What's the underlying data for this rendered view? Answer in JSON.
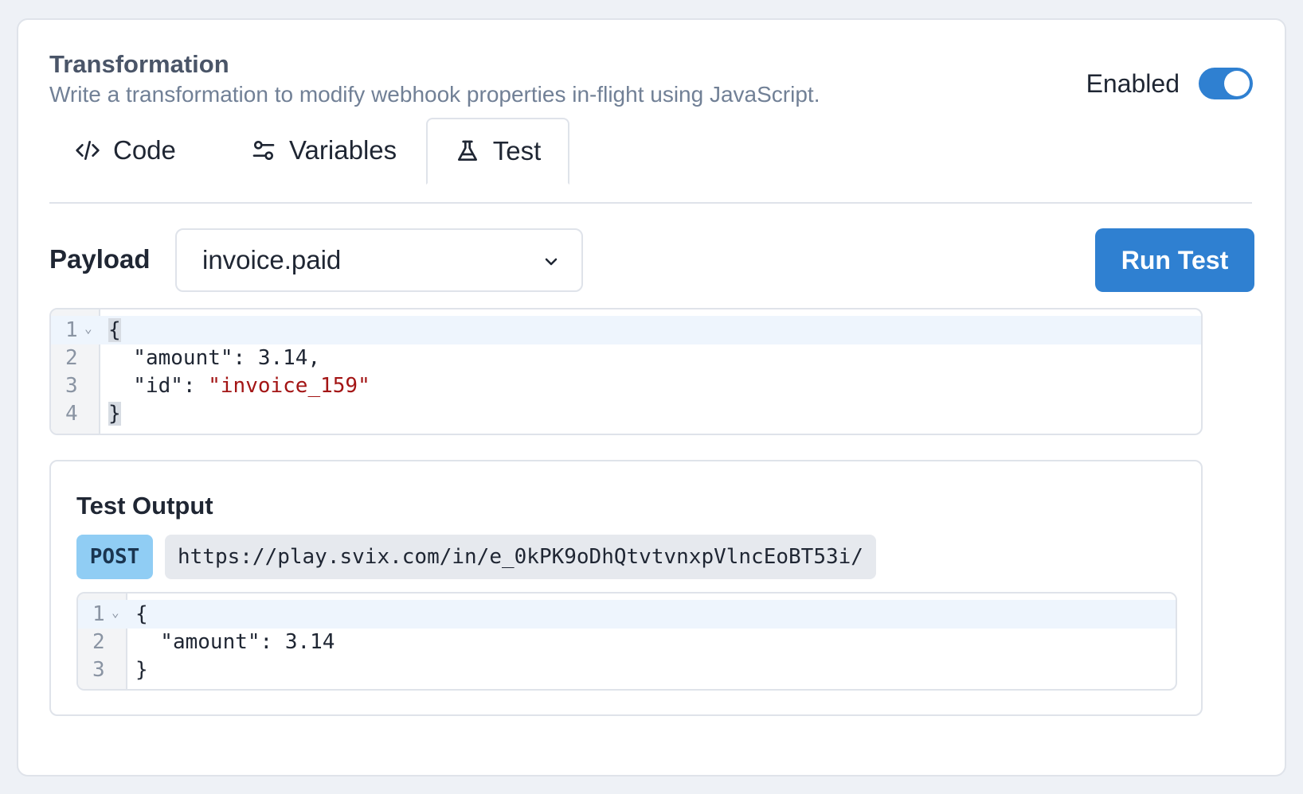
{
  "header": {
    "title": "Transformation",
    "subtitle": "Write a transformation to modify webhook properties in-flight using JavaScript.",
    "enabled_label": "Enabled",
    "enabled": true
  },
  "tabs": [
    {
      "label": "Code",
      "icon": "code-icon",
      "active": false
    },
    {
      "label": "Variables",
      "icon": "sliders-icon",
      "active": false
    },
    {
      "label": "Test",
      "icon": "flask-icon",
      "active": true
    }
  ],
  "payload": {
    "label": "Payload",
    "selected": "invoice.paid",
    "run_label": "Run Test"
  },
  "input_code": {
    "line_numbers": [
      "1",
      "2",
      "3",
      "4"
    ],
    "lines": [
      "{",
      "  \"amount\": 3.14,",
      "  \"id\": ",
      "}"
    ],
    "id_value": "\"invoice_159\""
  },
  "output": {
    "title": "Test Output",
    "method": "POST",
    "url": "https://play.svix.com/in/e_0kPK9oDhQtvtvnxpVlncEoBT53i/",
    "line_numbers": [
      "1",
      "2",
      "3"
    ],
    "lines": [
      "{",
      "  \"amount\": 3.14",
      "}"
    ]
  },
  "colors": {
    "accent": "#2f80d1",
    "method_badge": "#90cdf4",
    "string": "#a31515"
  }
}
